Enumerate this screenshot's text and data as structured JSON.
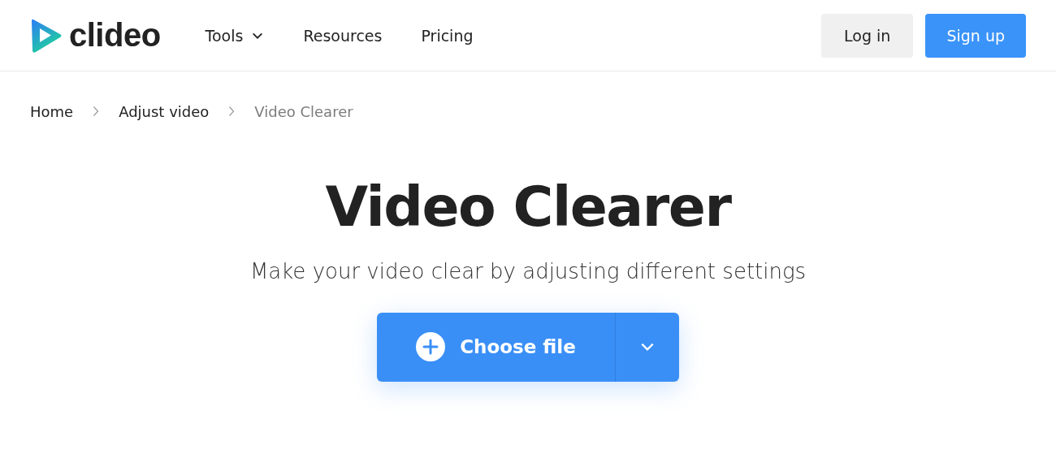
{
  "header": {
    "logo": {
      "text": "clideo"
    },
    "nav": [
      {
        "label": "Tools",
        "has_menu": true
      },
      {
        "label": "Resources",
        "has_menu": false
      },
      {
        "label": "Pricing",
        "has_menu": false
      }
    ],
    "buttons": [
      {
        "label": "Log in",
        "kind": "secondary"
      },
      {
        "label": "Sign up",
        "kind": "primary"
      }
    ]
  },
  "breadcrumb": [
    {
      "label": "Home",
      "current": false
    },
    {
      "label": "Adjust video",
      "current": false
    },
    {
      "label": "Video Clearer",
      "current": true
    }
  ],
  "title": "Video Clearer",
  "subtitle": "Make your video clear by adjusting different settings",
  "upload": {
    "label": "Choose file"
  }
}
